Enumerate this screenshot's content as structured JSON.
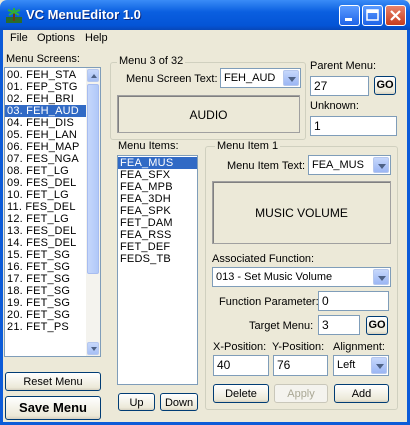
{
  "window": {
    "title": "VC MenuEditor 1.0"
  },
  "menubar": [
    "File",
    "Options",
    "Help"
  ],
  "menu_screens": {
    "label": "Menu Screens:",
    "items": [
      "00. FEH_STA",
      "01. FEP_STG",
      "02. FEH_BRI",
      "03. FEH_AUD",
      "04. FEH_DIS",
      "05. FEH_LAN",
      "06. FEH_MAP",
      "07. FES_NGA",
      "08. FET_LG",
      "09. FES_DEL",
      "10. FET_LG",
      "11. FES_DEL",
      "12. FET_LG",
      "13. FES_DEL",
      "14. FES_DEL",
      "15. FET_SG",
      "16. FET_SG",
      "17. FET_SG",
      "18. FET_SG",
      "19. FET_SG",
      "20. FET_SG",
      "21. FET_PS"
    ],
    "selected": 3
  },
  "left_buttons": {
    "reset": "Reset Menu",
    "save": "Save Menu"
  },
  "menu_group": {
    "label": "Menu 3 of 32",
    "screen_text_label": "Menu Screen Text:",
    "screen_text_value": "FEH_AUD",
    "preview": "AUDIO"
  },
  "parent_menu": {
    "label": "Parent Menu:",
    "value": "27",
    "go": "GO"
  },
  "unknown": {
    "label": "Unknown:",
    "value": "1"
  },
  "menu_items": {
    "label": "Menu Items:",
    "items": [
      "FEA_MUS",
      "FEA_SFX",
      "FEA_MPB",
      "FEA_3DH",
      "FEA_SPK",
      "FET_DAM",
      "FEA_RSS",
      "FET_DEF",
      "FEDS_TB"
    ],
    "selected": 0,
    "up": "Up",
    "down": "Down"
  },
  "item_group": {
    "label": "Menu Item 1",
    "item_text_label": "Menu Item Text:",
    "item_text_value": "FEA_MUS",
    "preview": "MUSIC VOLUME",
    "assoc_label": "Associated Function:",
    "assoc_value": "013 - Set Music Volume",
    "param_label": "Function Parameter:",
    "param_value": "0",
    "target_label": "Target Menu:",
    "target_value": "3",
    "target_go": "GO",
    "x_label": "X-Position:",
    "x_value": "40",
    "y_label": "Y-Position:",
    "y_value": "76",
    "align_label": "Alignment:",
    "align_value": "Left",
    "delete": "Delete",
    "apply": "Apply",
    "add": "Add"
  },
  "colors": {
    "title_blue": "#0a5fe0",
    "selection": "#316ac5",
    "window_bg": "#ece9d8"
  }
}
